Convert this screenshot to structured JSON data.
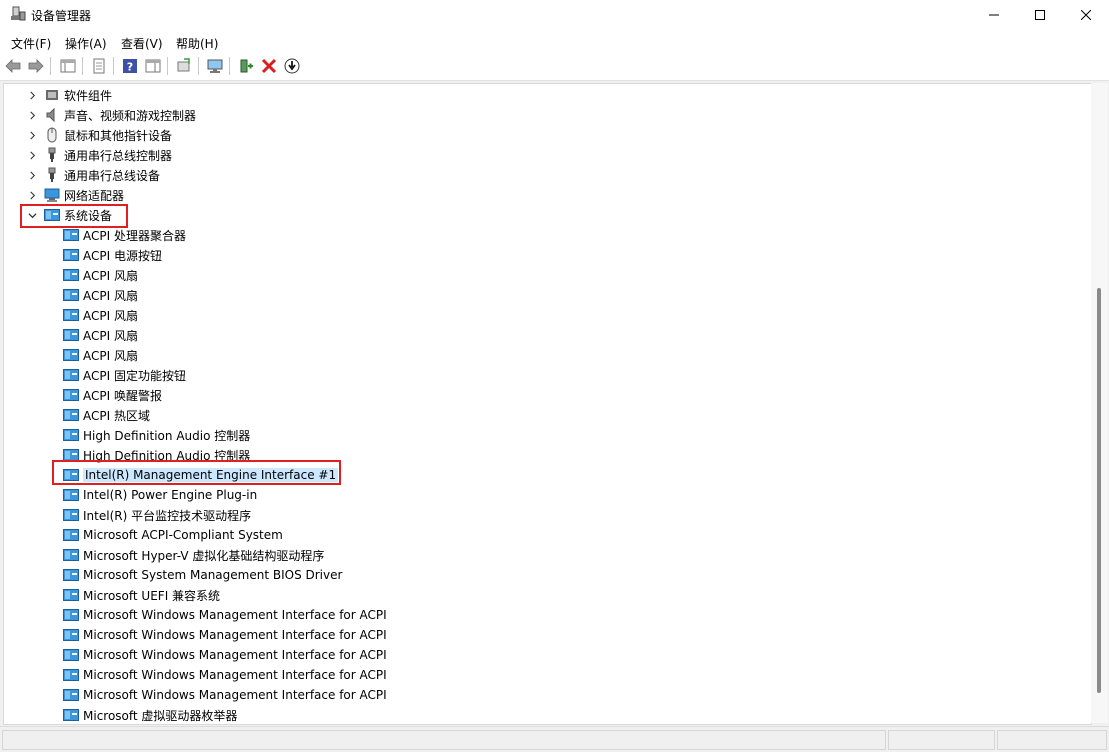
{
  "window": {
    "title": "设备管理器",
    "app_icon": "device-manager-icon",
    "controls": [
      "minimize-icon",
      "maximize-icon",
      "close-icon"
    ]
  },
  "menu": [
    {
      "label": "文件(F)"
    },
    {
      "label": "操作(A)"
    },
    {
      "label": "查看(V)"
    },
    {
      "label": "帮助(H)"
    }
  ],
  "toolbar": [
    "back-arrow-icon",
    "forward-arrow-icon",
    "show-hide-console-tree-icon",
    "properties-icon",
    "help-icon",
    "action-pane-icon",
    "update-driver-icon",
    "scan-hardware-changes-icon",
    "enable-device-icon",
    "uninstall-device-icon",
    "disable-device-icon"
  ],
  "tree": {
    "collapsed_categories": [
      {
        "label": "软件组件",
        "icon": "software-component-icon"
      },
      {
        "label": "声音、视频和游戏控制器",
        "icon": "speaker-icon"
      },
      {
        "label": "鼠标和其他指针设备",
        "icon": "mouse-icon"
      },
      {
        "label": "通用串行总线控制器",
        "icon": "usb-icon"
      },
      {
        "label": "通用串行总线设备",
        "icon": "usb-icon"
      },
      {
        "label": "网络适配器",
        "icon": "network-adapter-icon"
      }
    ],
    "expanded_category": {
      "label": "系统设备",
      "icon": "system-device-icon"
    },
    "devices": [
      {
        "label": "ACPI 处理器聚合器"
      },
      {
        "label": "ACPI 电源按钮"
      },
      {
        "label": "ACPI 风扇"
      },
      {
        "label": "ACPI 风扇"
      },
      {
        "label": "ACPI 风扇"
      },
      {
        "label": "ACPI 风扇"
      },
      {
        "label": "ACPI 风扇"
      },
      {
        "label": "ACPI 固定功能按钮"
      },
      {
        "label": "ACPI 唤醒警报"
      },
      {
        "label": "ACPI 热区域"
      },
      {
        "label": "High Definition Audio 控制器"
      },
      {
        "label": "High Definition Audio 控制器"
      },
      {
        "label": "Intel(R) Management Engine Interface #1",
        "selected": true
      },
      {
        "label": "Intel(R) Power Engine Plug-in"
      },
      {
        "label": "Intel(R) 平台监控技术驱动程序"
      },
      {
        "label": "Microsoft ACPI-Compliant System"
      },
      {
        "label": "Microsoft Hyper-V 虚拟化基础结构驱动程序"
      },
      {
        "label": "Microsoft System Management BIOS Driver"
      },
      {
        "label": "Microsoft UEFI 兼容系统"
      },
      {
        "label": "Microsoft Windows Management Interface for ACPI"
      },
      {
        "label": "Microsoft Windows Management Interface for ACPI"
      },
      {
        "label": "Microsoft Windows Management Interface for ACPI"
      },
      {
        "label": "Microsoft Windows Management Interface for ACPI"
      },
      {
        "label": "Microsoft Windows Management Interface for ACPI"
      },
      {
        "label": "Microsoft 虚拟驱动器枚举器"
      }
    ]
  },
  "colors": {
    "highlight_box": "#e02020",
    "selection": "#cce8ff",
    "device_icon": "#3a96dd"
  }
}
